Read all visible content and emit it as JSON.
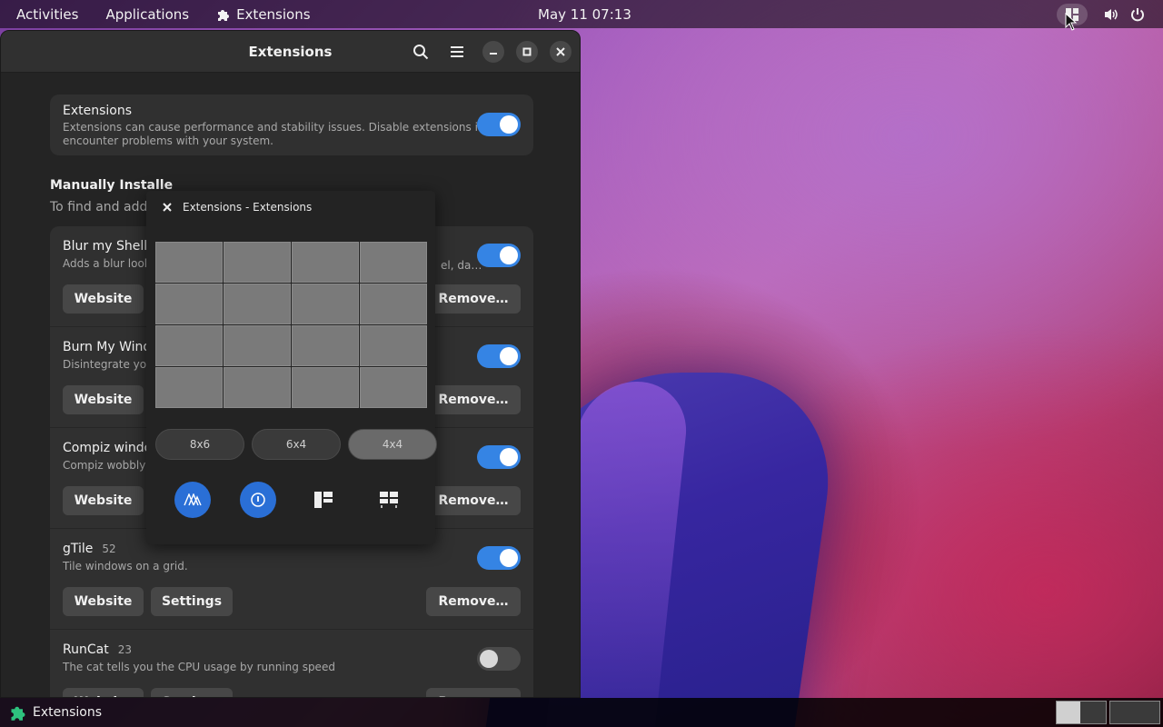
{
  "topbar": {
    "activities": "Activities",
    "applications": "Applications",
    "app_name": "Extensions",
    "clock": "May 11  07:13"
  },
  "window": {
    "title": "Extensions"
  },
  "global": {
    "title": "Extensions",
    "description_line1": "Extensions can cause performance and stability issues. Disable extensions if you",
    "description_line2": "encounter problems with your system.",
    "enabled": true
  },
  "section": {
    "title": "Manually Installe",
    "subtitle": "To find and add e"
  },
  "extensions": [
    {
      "name": "Blur my Shell",
      "version": "",
      "description": "Adds a blur look",
      "description_tail": "el, da…",
      "enabled": true,
      "website_label": "Website",
      "settings_label": "",
      "remove_label": "Remove…"
    },
    {
      "name": "Burn My Wind",
      "version": "",
      "description": "Disintegrate your",
      "description_tail": "",
      "enabled": true,
      "website_label": "Website",
      "settings_label": "",
      "remove_label": "Remove…"
    },
    {
      "name": "Compiz windo",
      "version": "",
      "description": "Compiz wobbly w",
      "description_tail": "",
      "enabled": true,
      "website_label": "Website",
      "settings_label": "",
      "remove_label": "Remove…"
    },
    {
      "name": "gTile",
      "version": "52",
      "description": "Tile windows on a grid.",
      "description_tail": "",
      "enabled": true,
      "website_label": "Website",
      "settings_label": "Settings",
      "remove_label": "Remove…"
    },
    {
      "name": "RunCat",
      "version": "23",
      "description": "The cat tells you the CPU usage by running speed",
      "description_tail": "",
      "enabled": false,
      "website_label": "Website",
      "settings_label": "Settings",
      "remove_label": "Remove…"
    }
  ],
  "popup": {
    "title": "Extensions - Extensions",
    "presets": [
      "8x6",
      "6x4",
      "4x4"
    ],
    "selected_preset": "4x4",
    "grid_rows": 4,
    "grid_cols": 4,
    "action_icons": [
      "auto-tile-main-icon",
      "auto-tile-ring-icon",
      "layout-left-icon",
      "layout-grid-icon"
    ]
  },
  "taskbar": {
    "item_label": "Extensions"
  },
  "colors": {
    "accent": "#3584e4",
    "window_bg": "#242424",
    "card_bg": "#303030"
  }
}
